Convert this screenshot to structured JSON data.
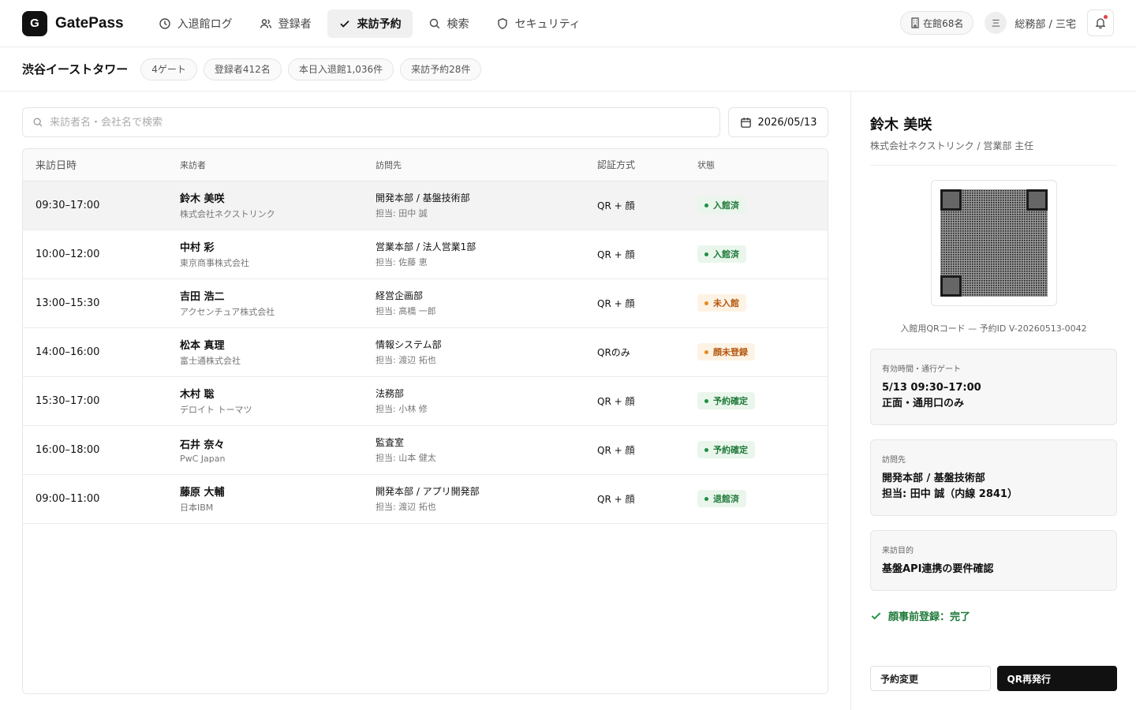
{
  "app": {
    "logo_letter": "G",
    "name": "GatePass"
  },
  "nav": [
    {
      "label": "入退館ログ",
      "icon": "clock-icon",
      "active": false
    },
    {
      "label": "登録者",
      "icon": "users-icon",
      "active": false
    },
    {
      "label": "来訪予約",
      "icon": "check-icon",
      "active": true
    },
    {
      "label": "検索",
      "icon": "search-icon",
      "active": false
    },
    {
      "label": "セキュリティ",
      "icon": "shield-icon",
      "active": false
    }
  ],
  "header_right": {
    "occupancy": "在館68名",
    "user_initial": "三",
    "user": "総務部 / 三宅"
  },
  "site": {
    "name": "渋谷イーストタワー",
    "tags": [
      "4ゲート",
      "登録者412名",
      "本日入退館1,036件",
      "来訪予約28件"
    ]
  },
  "search": {
    "placeholder": "来訪者名・会社名で検索",
    "date": "2026/05/13"
  },
  "table": {
    "headers": [
      "来訪日時",
      "来訪者",
      "訪問先",
      "認証方式",
      "状態"
    ],
    "rows": [
      {
        "time": "09:30–17:00",
        "name": "鈴木 美咲",
        "company": "株式会社ネクストリンク",
        "dest": "開発本部 / 基盤技術部",
        "contact": "担当: 田中 誠",
        "auth": "QR + 顔",
        "status": "入館済",
        "tone": "green",
        "selected": true
      },
      {
        "time": "10:00–12:00",
        "name": "中村 彩",
        "company": "東京商事株式会社",
        "dest": "営業本部 / 法人営業1部",
        "contact": "担当: 佐藤 恵",
        "auth": "QR + 顔",
        "status": "入館済",
        "tone": "green",
        "selected": false
      },
      {
        "time": "13:00–15:30",
        "name": "吉田 浩二",
        "company": "アクセンチュア株式会社",
        "dest": "経営企画部",
        "contact": "担当: 高橋 一郎",
        "auth": "QR + 顔",
        "status": "未入館",
        "tone": "orange",
        "selected": false
      },
      {
        "time": "14:00–16:00",
        "name": "松本 真理",
        "company": "富士通株式会社",
        "dest": "情報システム部",
        "contact": "担当: 渡辺 拓也",
        "auth": "QRのみ",
        "status": "顔未登録",
        "tone": "orange",
        "selected": false
      },
      {
        "time": "15:30–17:00",
        "name": "木村 聡",
        "company": "デロイト トーマツ",
        "dest": "法務部",
        "contact": "担当: 小林 修",
        "auth": "QR + 顔",
        "status": "予約確定",
        "tone": "green",
        "selected": false
      },
      {
        "time": "16:00–18:00",
        "name": "石井 奈々",
        "company": "PwC Japan",
        "dest": "監査室",
        "contact": "担当: 山本 健太",
        "auth": "QR + 顔",
        "status": "予約確定",
        "tone": "green",
        "selected": false
      },
      {
        "time": "09:00–11:00",
        "name": "藤原 大輔",
        "company": "日本IBM",
        "dest": "開発本部 / アプリ開発部",
        "contact": "担当: 渡辺 拓也",
        "auth": "QR + 顔",
        "status": "退館済",
        "tone": "green",
        "selected": false
      }
    ]
  },
  "detail": {
    "name": "鈴木 美咲",
    "company": "株式会社ネクストリンク / 営業部 主任",
    "qr_caption": "入館用QRコード — 予約ID V-20260513-0042",
    "cards": [
      {
        "label": "有効時間・通行ゲート",
        "lines": [
          "5/13 09:30–17:00",
          "正面・通用口のみ"
        ]
      },
      {
        "label": "訪問先",
        "lines": [
          "開発本部 / 基盤技術部",
          "担当: 田中 誠（内線 2841）"
        ]
      },
      {
        "label": "来訪目的",
        "lines": [
          "基盤API連携の要件確認"
        ]
      }
    ],
    "face_status": "顔事前登録：完了",
    "btn_change": "予約変更",
    "btn_reissue": "QR再発行"
  }
}
